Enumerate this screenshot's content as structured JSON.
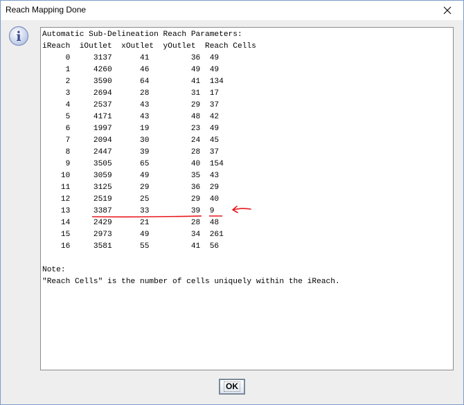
{
  "window": {
    "title": "Reach Mapping Done",
    "close_symbol": "✕"
  },
  "dialog": {
    "icon": "info-icon",
    "icon_letter": "i",
    "heading": "Automatic Sub-Delineation Reach Parameters:",
    "columns": [
      "iReach",
      "iOutlet",
      "xOutlet",
      "yOutlet",
      "Reach Cells"
    ],
    "rows": [
      [
        "0",
        "3137",
        "41",
        "36",
        "49"
      ],
      [
        "1",
        "4260",
        "46",
        "49",
        "49"
      ],
      [
        "2",
        "3590",
        "64",
        "41",
        "134"
      ],
      [
        "3",
        "2694",
        "28",
        "31",
        "17"
      ],
      [
        "4",
        "2537",
        "43",
        "29",
        "37"
      ],
      [
        "5",
        "4171",
        "43",
        "48",
        "42"
      ],
      [
        "6",
        "1997",
        "19",
        "23",
        "49"
      ],
      [
        "7",
        "2094",
        "30",
        "24",
        "45"
      ],
      [
        "8",
        "2447",
        "39",
        "28",
        "37"
      ],
      [
        "9",
        "3505",
        "65",
        "40",
        "154"
      ],
      [
        "10",
        "3059",
        "49",
        "35",
        "43"
      ],
      [
        "11",
        "3125",
        "29",
        "36",
        "29"
      ],
      [
        "12",
        "2519",
        "25",
        "29",
        "40"
      ],
      [
        "13",
        "3387",
        "33",
        "39",
        "9"
      ],
      [
        "14",
        "2429",
        "21",
        "28",
        "48"
      ],
      [
        "15",
        "2973",
        "49",
        "34",
        "261"
      ],
      [
        "16",
        "3581",
        "55",
        "41",
        "56"
      ]
    ],
    "note_label": "Note:",
    "note_text": "\"Reach Cells\" is the number of cells uniquely within the iReach.",
    "annotation_color": "#e8171c"
  },
  "buttons": {
    "ok_label": "OK"
  }
}
